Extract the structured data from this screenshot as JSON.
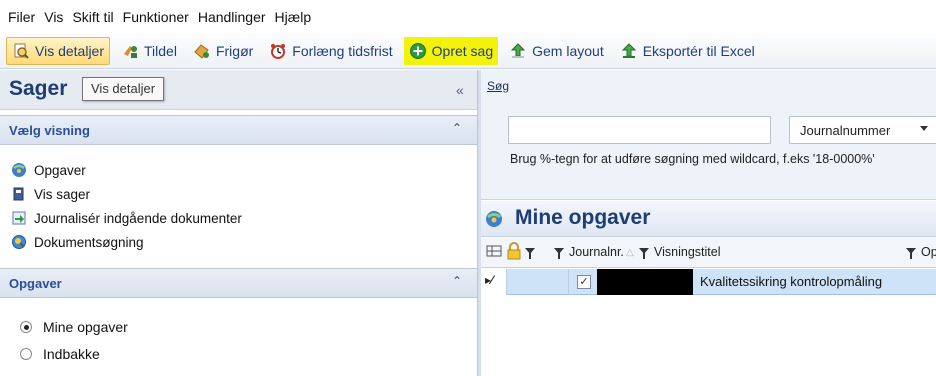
{
  "menu": [
    "Filer",
    "Vis",
    "Skift til",
    "Funktioner",
    "Handlinger",
    "Hjælp"
  ],
  "toolbar": [
    {
      "label": "Vis detaljer",
      "icon": "magnifier-document-icon",
      "state": "hover"
    },
    {
      "label": "Tildel",
      "icon": "assign-icon",
      "state": "normal"
    },
    {
      "label": "Frigør",
      "icon": "release-icon",
      "state": "normal"
    },
    {
      "label": "Forlæng tidsfrist",
      "icon": "alarm-clock-icon",
      "state": "normal"
    },
    {
      "label": "Opret sag",
      "icon": "add-circle-icon",
      "state": "highlight"
    },
    {
      "label": "Gem layout",
      "icon": "save-layout-icon",
      "state": "normal"
    },
    {
      "label": "Eksportér til Excel",
      "icon": "export-excel-icon",
      "state": "normal"
    }
  ],
  "tooltip": "Vis detaljer",
  "left": {
    "title": "Sager",
    "sections": {
      "view": {
        "label": "Vælg visning",
        "items": [
          {
            "label": "Opgaver",
            "icon": "tasks-icon"
          },
          {
            "label": "Vis sager",
            "icon": "cases-icon"
          },
          {
            "label": "Journalisér indgående dokumenter",
            "icon": "journalize-icon"
          },
          {
            "label": "Dokumentsøgning",
            "icon": "document-search-icon"
          }
        ]
      },
      "tasks": {
        "label": "Opgaver",
        "options": [
          {
            "label": "Mine opgaver",
            "selected": true
          },
          {
            "label": "Indbakke",
            "selected": false
          }
        ]
      }
    }
  },
  "search": {
    "label": "Søg",
    "value": "",
    "field": "Journalnummer",
    "hint": "Brug %-tegn for at udføre søgning med wildcard, f.eks '18-0000%'"
  },
  "my_tasks": {
    "title": "Mine opgaver",
    "columns": {
      "journal": "Journalnr.",
      "title": "Visningstitel",
      "next": "Op"
    },
    "rows": [
      {
        "indicator": "▸⁄",
        "checked": true,
        "journal": "",
        "title": "Kvalitetssikring kontrolopmåling"
      }
    ]
  },
  "colors": {
    "accent": "#1d3d75",
    "highlight": "#f3f20a",
    "selection": "#cfe3f8"
  }
}
